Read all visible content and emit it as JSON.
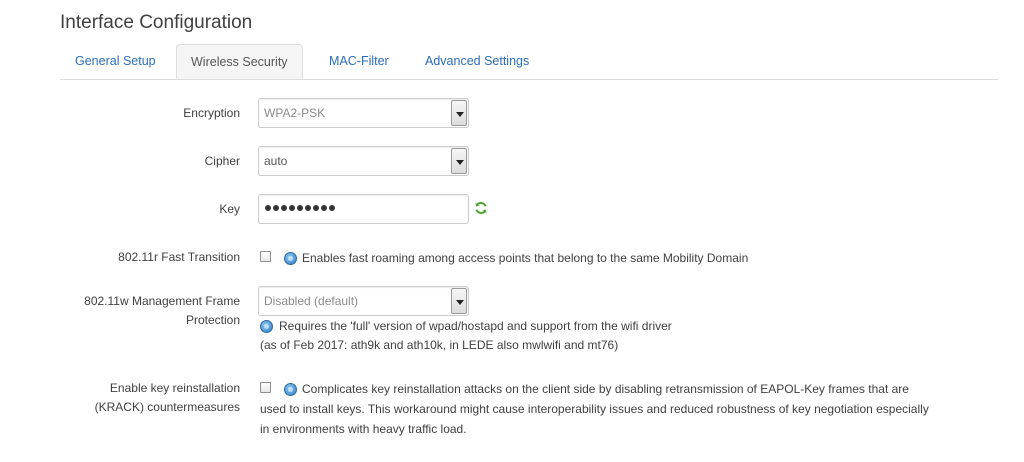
{
  "page": {
    "title": "Interface Configuration"
  },
  "tabs": [
    {
      "label": "General Setup",
      "active": false
    },
    {
      "label": "Wireless Security",
      "active": true
    },
    {
      "label": "MAC-Filter",
      "active": false
    },
    {
      "label": "Advanced Settings",
      "active": false
    }
  ],
  "form": {
    "encryption": {
      "label": "Encryption",
      "value": "WPA2-PSK"
    },
    "cipher": {
      "label": "Cipher",
      "value": "auto"
    },
    "key": {
      "label": "Key",
      "masked_length": 9
    },
    "fast_transition": {
      "label": "802.11r Fast Transition",
      "checked": false,
      "description": "Enables fast roaming among access points that belong to the same Mobility Domain"
    },
    "mgmt_frame_protection": {
      "label_line1": "802.11w Management Frame",
      "label_line2": "Protection",
      "value": "Disabled (default)",
      "description_line1": "Requires the 'full' version of wpad/hostapd and support from the wifi driver",
      "description_line2": "(as of Feb 2017: ath9k and ath10k, in LEDE also mwlwifi and mt76)"
    },
    "krack": {
      "label_line1": "Enable key reinstallation",
      "label_line2": "(KRACK) countermeasures",
      "checked": false,
      "description_line1": "Complicates key reinstallation attacks on the client side by disabling retransmission of EAPOL-Key frames that are",
      "description_line2": "used to install keys. This workaround might cause interoperability issues and reduced robustness of key negotiation especially",
      "description_line3": "in environments with heavy traffic load."
    }
  },
  "colors": {
    "link": "#2a6ebb",
    "text": "#404040",
    "border": "#dddddd",
    "refresh_icon": "#4aa32f"
  }
}
